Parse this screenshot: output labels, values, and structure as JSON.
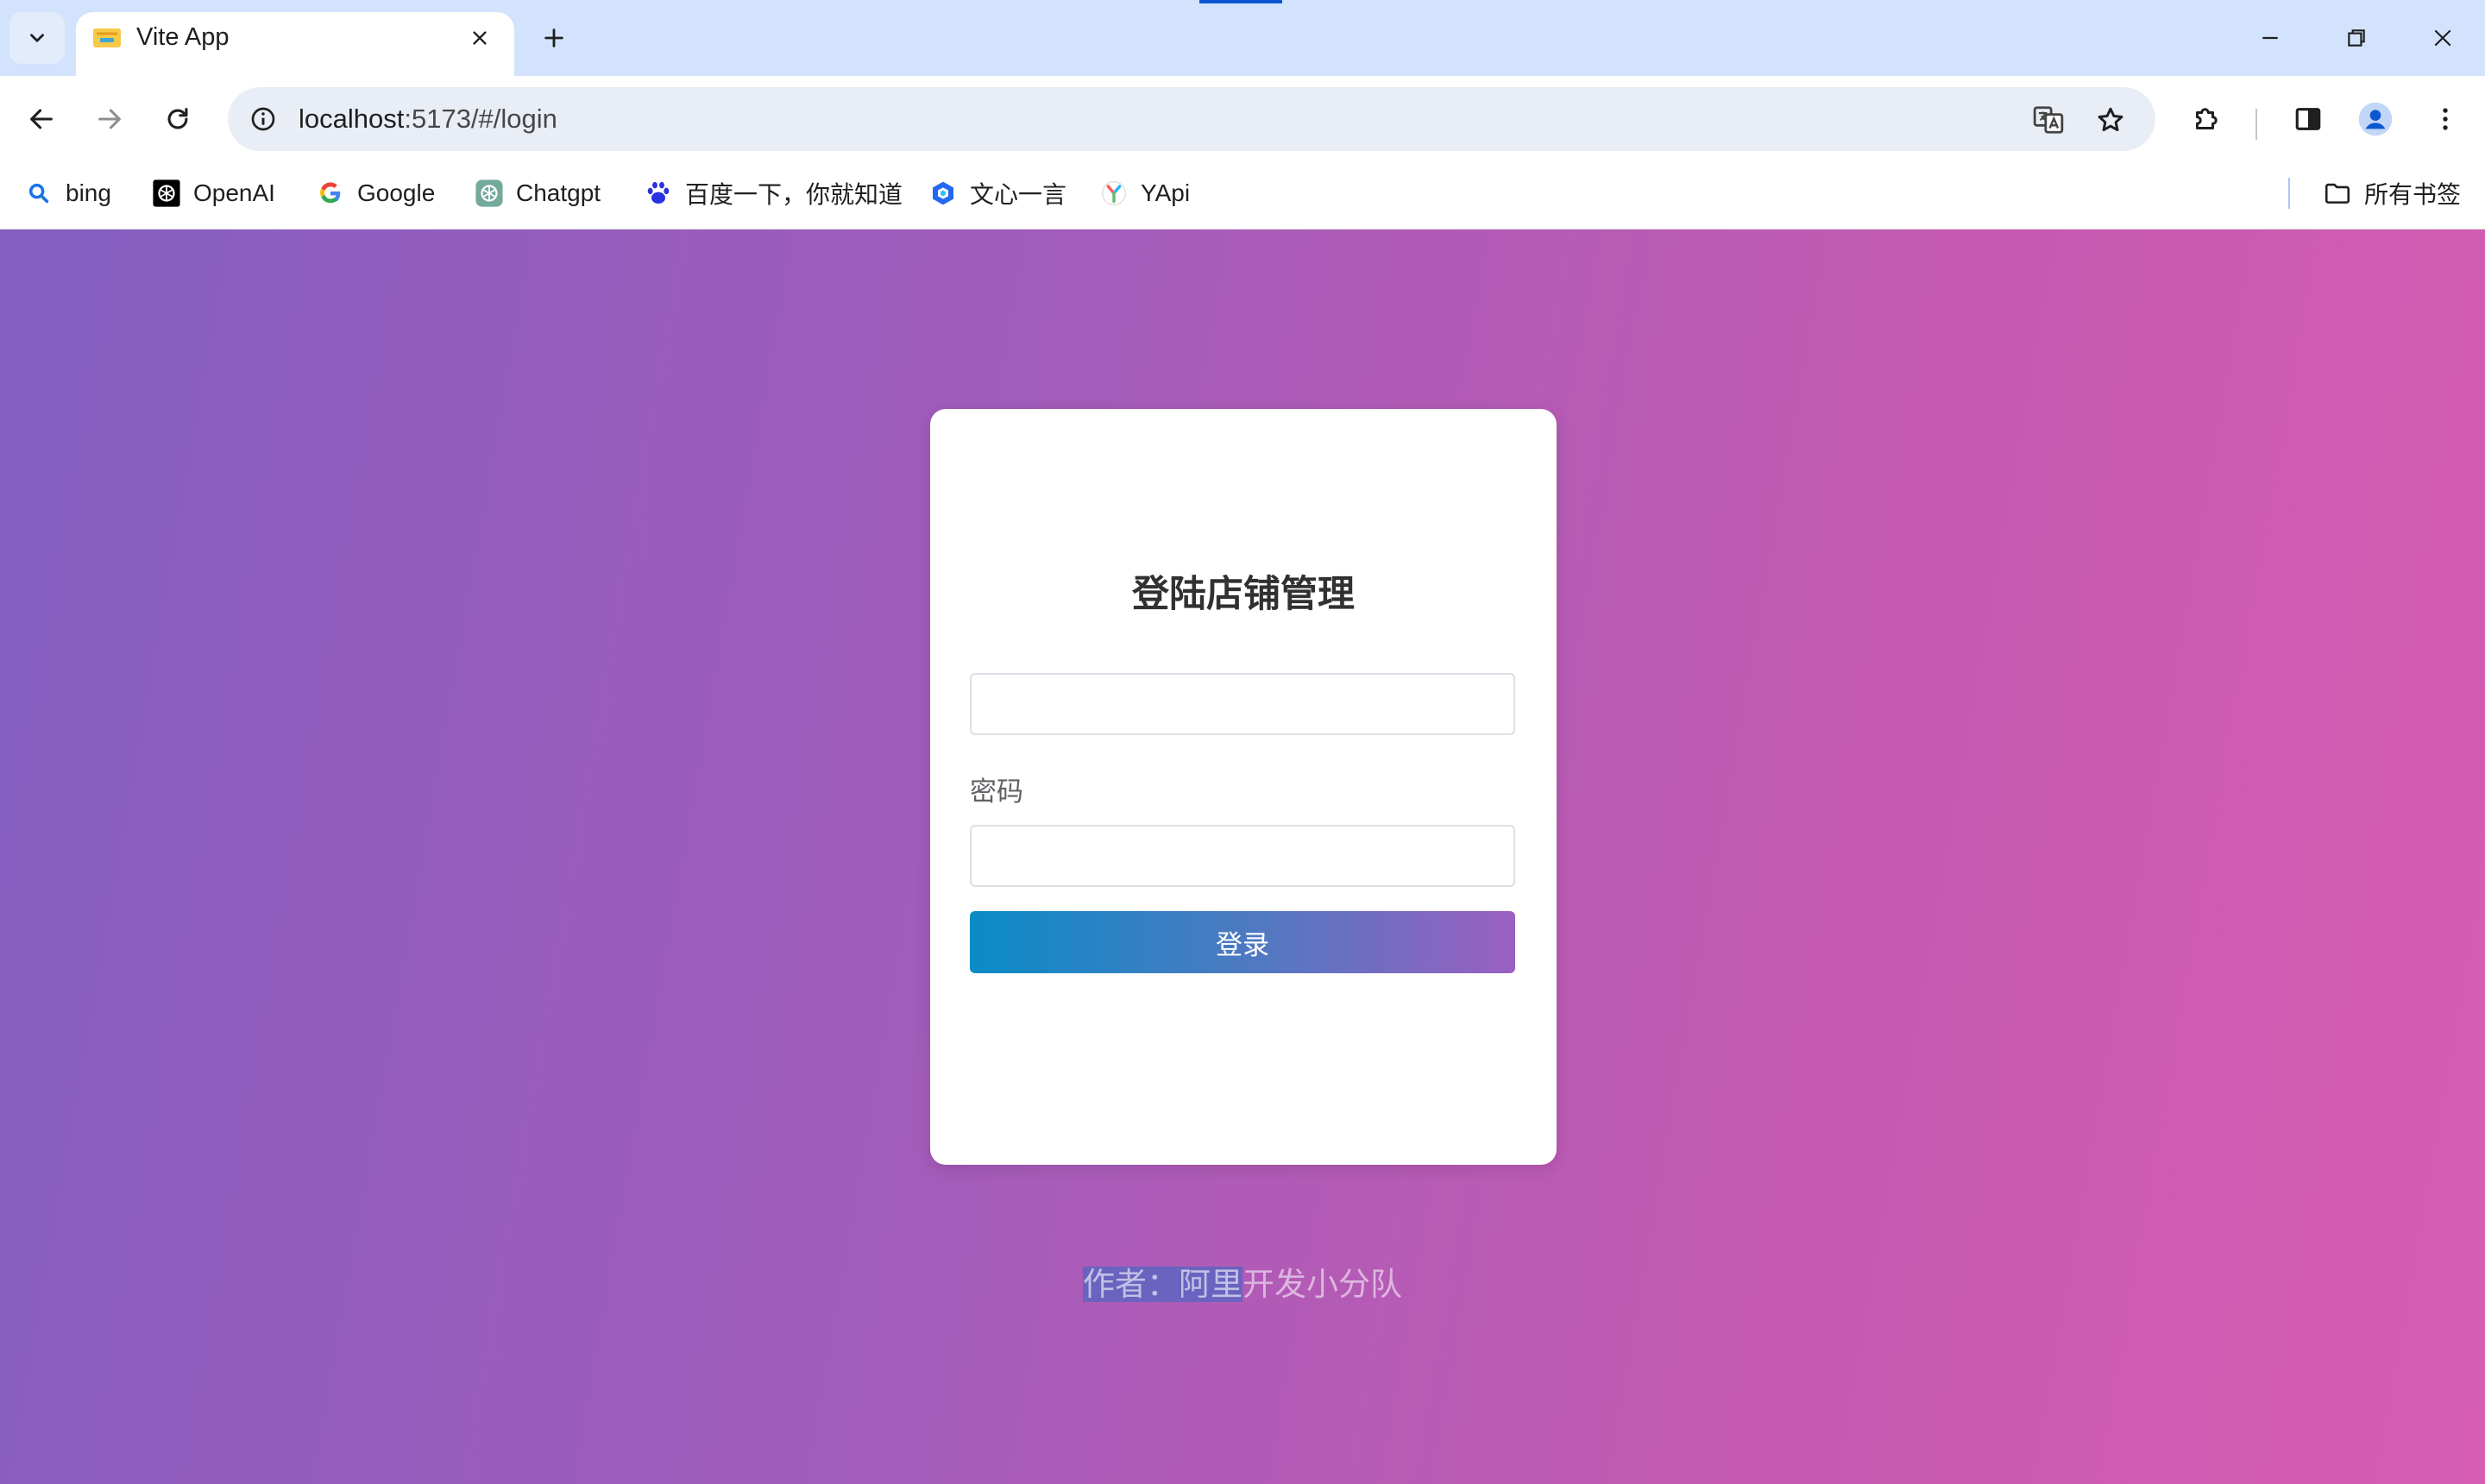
{
  "browser": {
    "tab": {
      "title": "Vite App"
    },
    "url": {
      "host": "localhost",
      "path": ":5173/#/login"
    },
    "bookmarks": [
      {
        "label": "bing",
        "icon": "bing-search-icon"
      },
      {
        "label": "OpenAI",
        "icon": "openai-icon"
      },
      {
        "label": "Google",
        "icon": "google-icon"
      },
      {
        "label": "Chatgpt",
        "icon": "chatgpt-icon"
      },
      {
        "label": "百度一下，你就知道",
        "icon": "baidu-paw-icon"
      },
      {
        "label": "文心一言",
        "icon": "wenxin-icon"
      },
      {
        "label": "YApi",
        "icon": "yapi-icon"
      }
    ],
    "all_bookmarks_label": "所有书签"
  },
  "login": {
    "title": "登陆店铺管理",
    "username_value": "",
    "password_label": "密码",
    "password_value": "",
    "submit_label": "登录"
  },
  "footer": {
    "highlighted": "作者：阿里",
    "rest": "开发小分队"
  },
  "colors": {
    "gradient_start": "#845ec2",
    "gradient_end": "#d65db1",
    "button_start": "#0a8bc6",
    "button_end": "#9b5fc2",
    "tabstrip": "#d3e3fd"
  }
}
